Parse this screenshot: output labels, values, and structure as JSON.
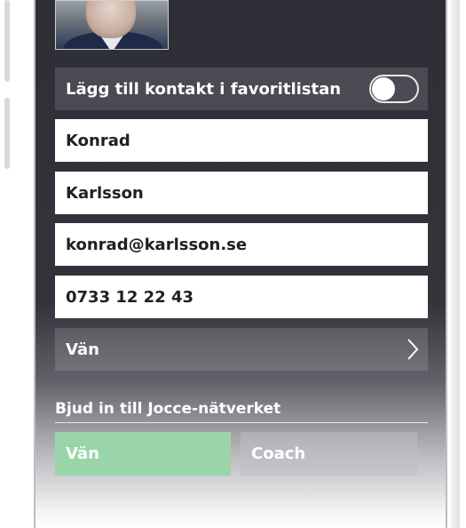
{
  "contact": {
    "favorite_label": "Lägg till kontakt i favoritlistan",
    "favorite_on": false,
    "first_name": "Konrad",
    "last_name": "Karlsson",
    "email": "konrad@karlsson.se",
    "phone": "0733 12 22 43",
    "relation": "Vän"
  },
  "invite": {
    "label": "Bjud in till Jocce-nätverket",
    "options": [
      "Vän",
      "Coach"
    ],
    "selected": "Vän"
  },
  "colors": {
    "background": "#2e2e36",
    "row_dark": "#4a4a52",
    "selected_green": "#9ad5a9"
  }
}
